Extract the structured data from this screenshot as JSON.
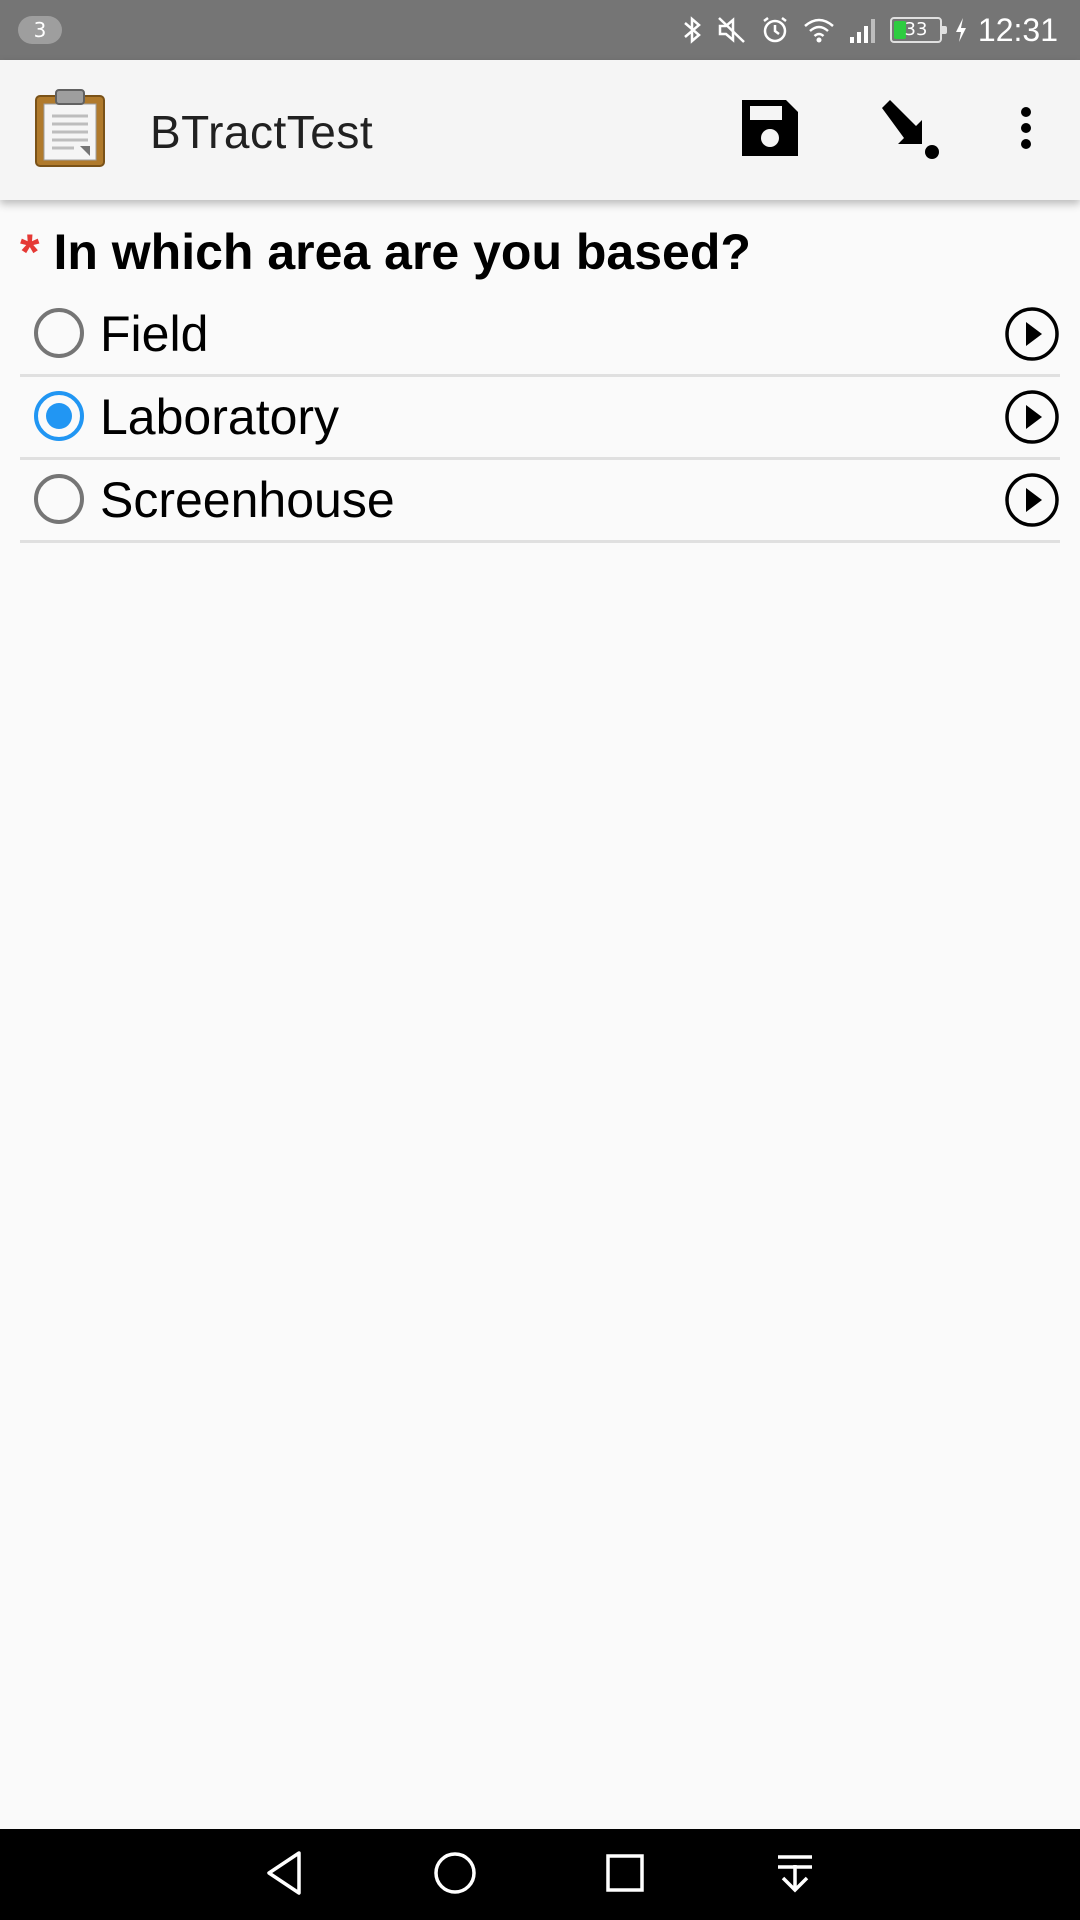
{
  "status_bar": {
    "notification_count": "3",
    "battery_level": "33",
    "time": "12:31",
    "icons": [
      "bluetooth-icon",
      "mute-icon",
      "alarm-icon",
      "wifi-icon",
      "signal-icon",
      "battery-icon",
      "charging-icon"
    ]
  },
  "app_bar": {
    "title": "BTractTest",
    "logo_icon": "clipboard-icon",
    "actions": [
      "save-icon",
      "jump-icon",
      "overflow-menu-icon"
    ]
  },
  "form": {
    "required_marker": "*",
    "question": "In which area are you based?",
    "options": [
      {
        "label": "Field",
        "selected": false
      },
      {
        "label": "Laboratory",
        "selected": true
      },
      {
        "label": "Screenhouse",
        "selected": false
      }
    ]
  },
  "nav_bar": {
    "buttons": [
      "back-icon",
      "home-icon",
      "recents-icon",
      "pull-down-icon"
    ]
  },
  "colors": {
    "accent": "#2196f3",
    "required": "#e53935",
    "status_bar": "#757575",
    "app_bar": "#f5f5f5",
    "battery": "#2ecc40"
  }
}
